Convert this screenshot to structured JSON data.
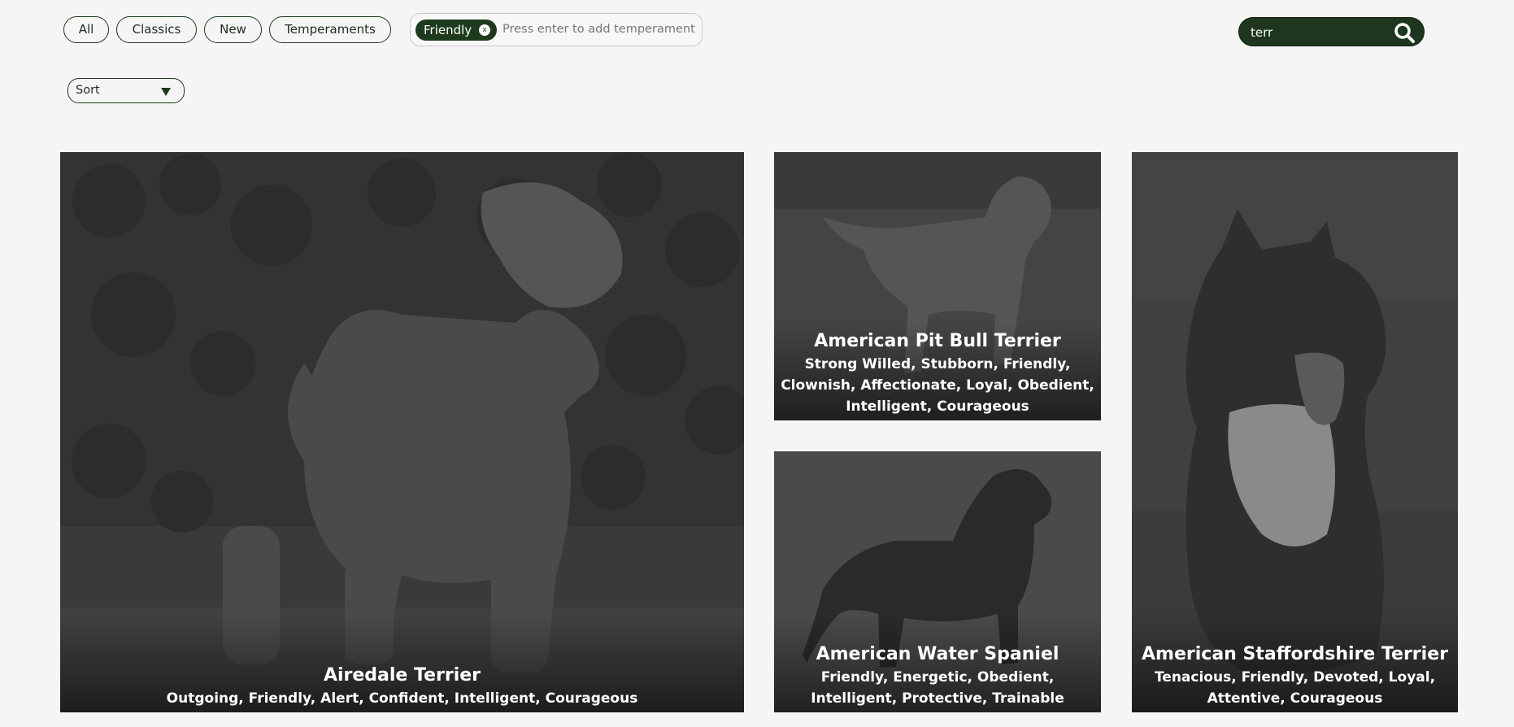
{
  "filters": {
    "all": "All",
    "classics": "Classics",
    "new": "New",
    "temperaments": "Temperaments"
  },
  "temperament_filter": {
    "chips": [
      "Friendly"
    ],
    "chip_remove": "x",
    "placeholder": "Press enter to add temperament"
  },
  "search": {
    "value": "terr",
    "icon": "search-icon"
  },
  "sort": {
    "label": "Sort",
    "icon": "caret-down-icon"
  },
  "breeds": [
    {
      "name": "Airedale Terrier",
      "temperaments": "Outgoing, Friendly, Alert, Confident, Intelligent, Courageous"
    },
    {
      "name": "American Pit Bull Terrier",
      "temperaments": "Strong Willed, Stubborn, Friendly, Clownish, Affectionate, Loyal, Obedient, Intelligent, Courageous"
    },
    {
      "name": "American Water Spaniel",
      "temperaments": "Friendly, Energetic, Obedient, Intelligent, Protective, Trainable"
    },
    {
      "name": "American Staffordshire Terrier",
      "temperaments": "Tenacious, Friendly, Devoted, Loyal, Attentive, Courageous"
    }
  ],
  "colors": {
    "accent": "#1d3a1d",
    "background": "#f5f5f5",
    "card_overlay": "#3b3b3b"
  }
}
